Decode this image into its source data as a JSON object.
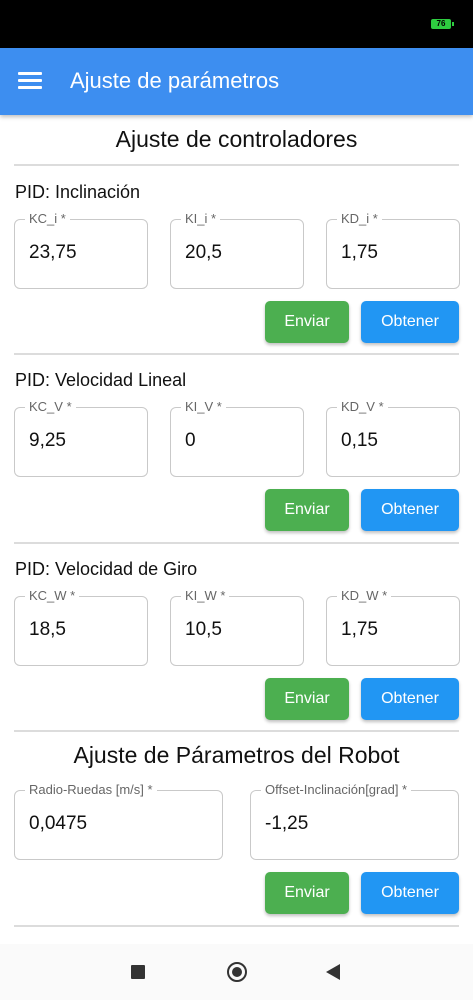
{
  "status_bar": {
    "battery": "76"
  },
  "app_bar": {
    "title": "Ajuste de parámetros"
  },
  "controllers": {
    "title": "Ajuste de controladores",
    "groups": [
      {
        "title": "PID: Inclinación",
        "fields": [
          {
            "label": "KC_i *",
            "value": "23,75"
          },
          {
            "label": "KI_i *",
            "value": "20,5"
          },
          {
            "label": "KD_i *",
            "value": "1,75"
          }
        ],
        "send_label": "Enviar",
        "get_label": "Obtener"
      },
      {
        "title": "PID: Velocidad Lineal",
        "fields": [
          {
            "label": "KC_V *",
            "value": "9,25"
          },
          {
            "label": "KI_V *",
            "value": "0"
          },
          {
            "label": "KD_V *",
            "value": "0,15"
          }
        ],
        "send_label": "Enviar",
        "get_label": "Obtener"
      },
      {
        "title": "PID: Velocidad de Giro",
        "fields": [
          {
            "label": "KC_W *",
            "value": "18,5"
          },
          {
            "label": "KI_W *",
            "value": "10,5"
          },
          {
            "label": "KD_W *",
            "value": "1,75"
          }
        ],
        "send_label": "Enviar",
        "get_label": "Obtener"
      }
    ]
  },
  "robot": {
    "title": "Ajuste de Párametros del Robot",
    "fields": [
      {
        "label": "Radio-Ruedas [m/s] *",
        "value": "0,0475"
      },
      {
        "label": "Offset-Inclinación[grad] *",
        "value": "-1,25"
      }
    ],
    "send_label": "Enviar",
    "get_label": "Obtener"
  },
  "colors": {
    "app_bar": "#3d8ef0",
    "send_button": "#4caf50",
    "get_button": "#2196f3"
  }
}
